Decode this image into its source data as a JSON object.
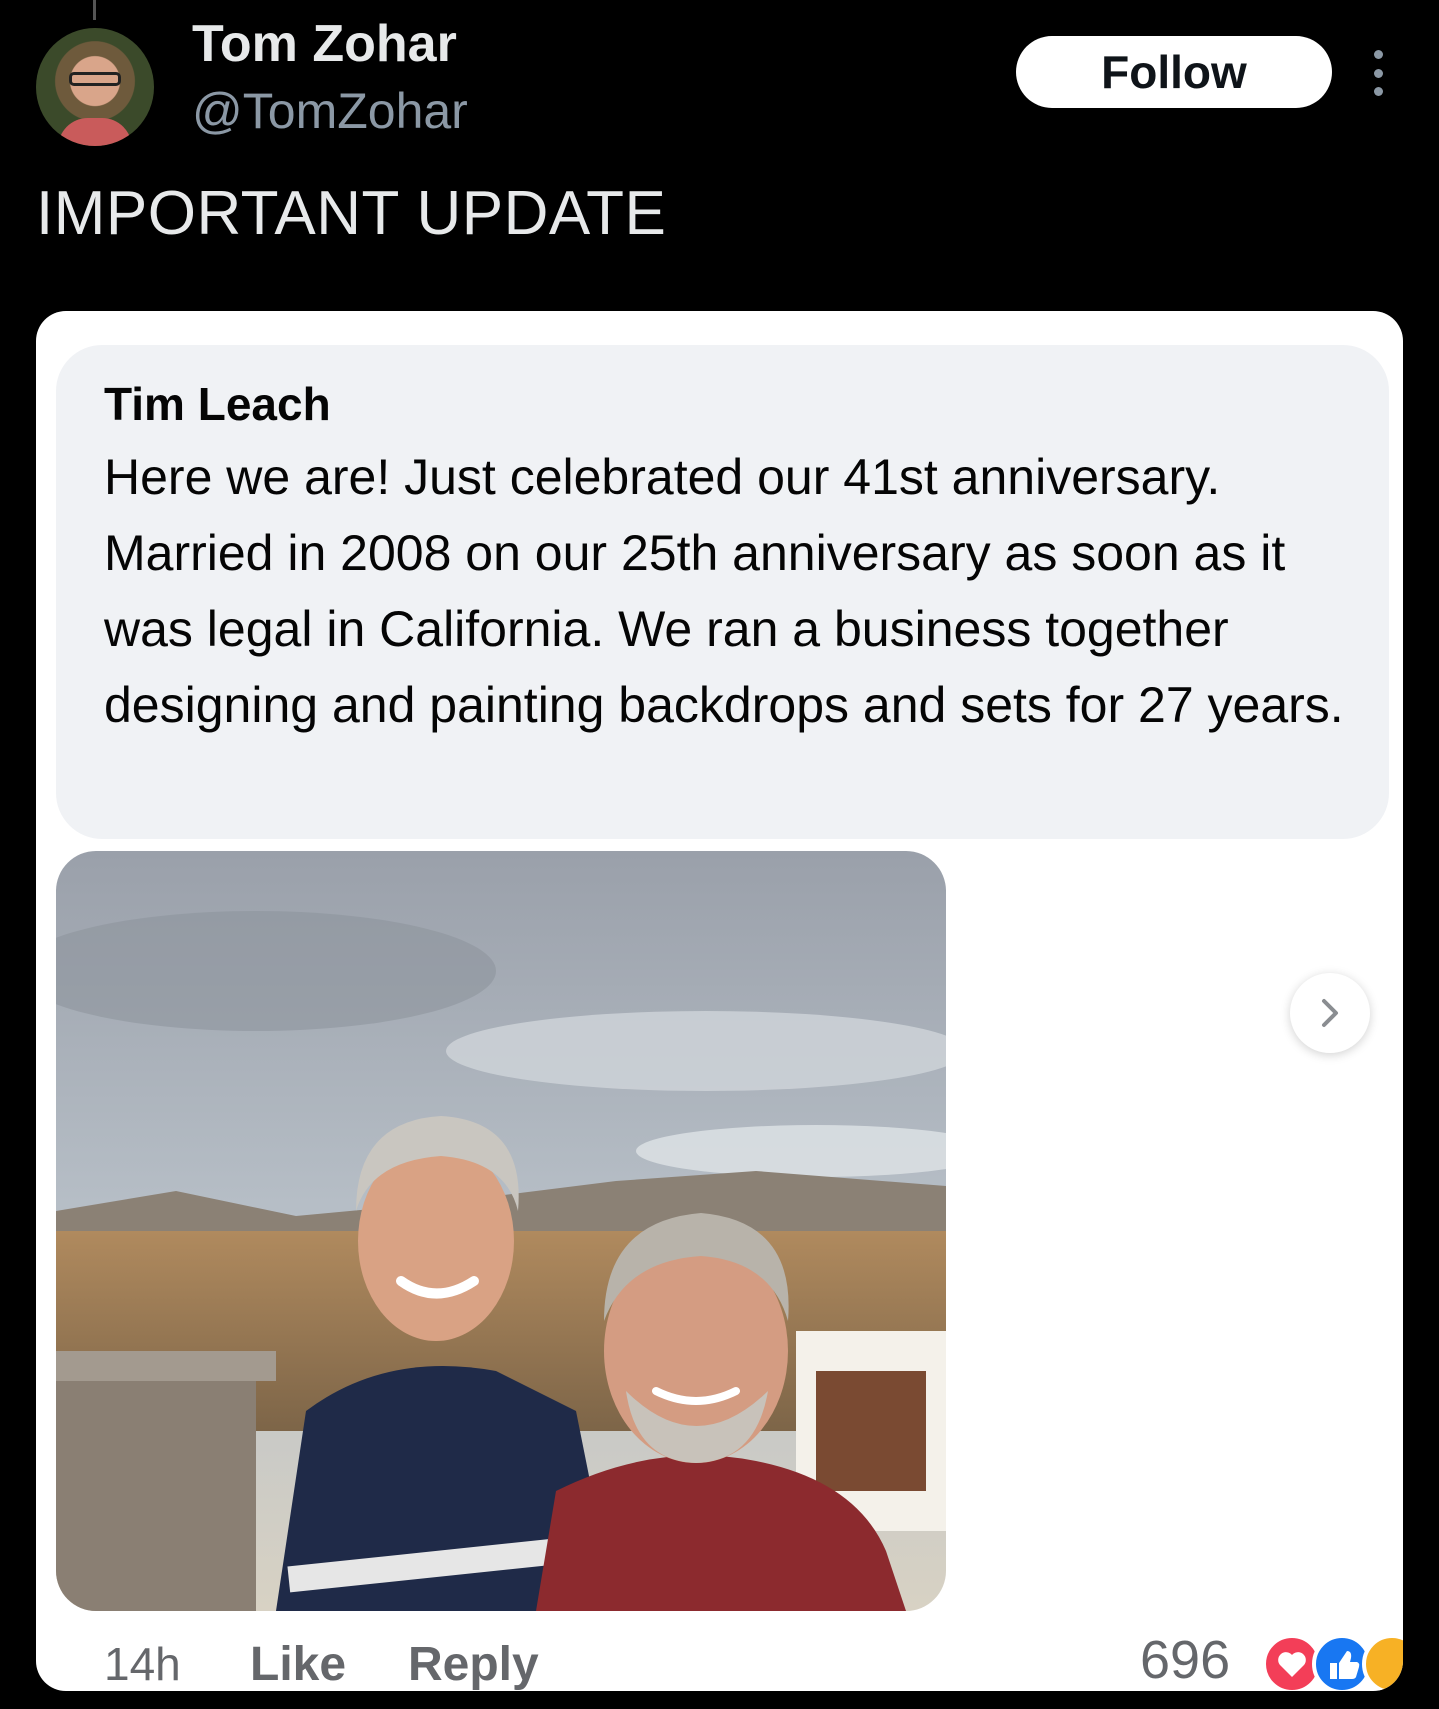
{
  "tweet": {
    "author_name": "Tom Zohar",
    "author_handle": "@TomZohar",
    "follow_label": "Follow",
    "text": "IMPORTANT UPDATE"
  },
  "comment": {
    "author": "Tim Leach",
    "text": "Here we are! Just celebrated our 41st anniversary. Married in 2008 on our 25th anniversary as soon as it was legal in California. We ran a business together designing and painting backdrops and sets for 27 years.",
    "time": "14h",
    "like_label": "Like",
    "reply_label": "Reply",
    "reaction_count": "696",
    "reaction_icons": [
      "heart-reaction-icon",
      "like-reaction-icon",
      "haha-reaction-icon"
    ]
  },
  "colors": {
    "background": "#000000",
    "follow_bg": "#ffffff",
    "bubble_bg": "#f0f2f5",
    "heart": "#f33e58",
    "like": "#1877f2"
  }
}
